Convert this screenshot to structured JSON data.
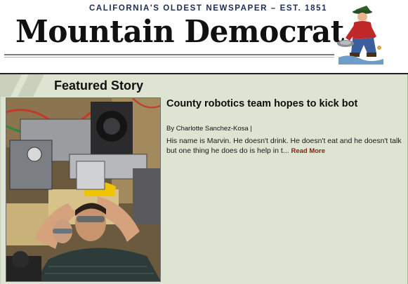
{
  "masthead": {
    "tagline": "California's Oldest Newspaper  –  Est. 1851",
    "nameplate": "Mountain Democrat",
    "logo_icon": "gold-miner-icon"
  },
  "featured": {
    "section_title": "Featured Story",
    "headline": "County robotics team hopes to kick bot",
    "byline": "By Charlotte Sanchez-Kosa |",
    "excerpt": "His name is Marvin. He doesn't drink. He doesn't eat and he doesn't talk but one thing he does do is help in t...",
    "read_more_label": "Read More",
    "photo_icon": "robot-photo-icon"
  },
  "colors": {
    "panel_background": "#dde4d2",
    "tagline_color": "#1c2c55",
    "read_more_color": "#8a1c0f"
  }
}
